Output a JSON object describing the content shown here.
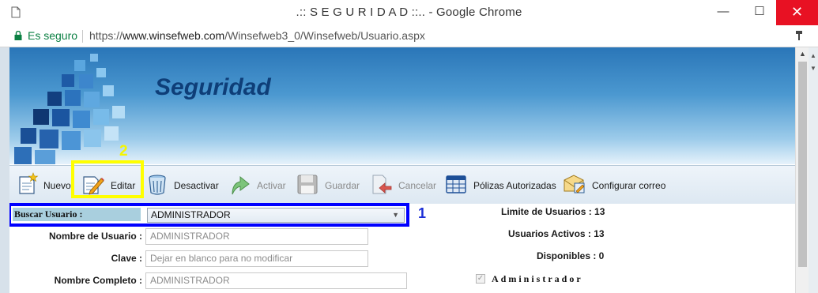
{
  "window": {
    "title": ".:: S E G U R I D A D ::.. - Google Chrome",
    "minimize": "—",
    "maximize": "☐",
    "close": "✕"
  },
  "address": {
    "secure_label": "Es seguro",
    "url_scheme": "https://",
    "url_host": "www.winsefweb.com",
    "url_path": "/Winsefweb3_0/Winsefweb/Usuario.aspx"
  },
  "banner": {
    "title": "Seguridad"
  },
  "toolbar": {
    "items": [
      {
        "label": "Nuevo",
        "icon": "new-document-icon",
        "enabled": true
      },
      {
        "label": "Editar",
        "icon": "edit-pencil-icon",
        "enabled": true
      },
      {
        "label": "Desactivar",
        "icon": "trash-bin-icon",
        "enabled": true
      },
      {
        "label": "Activar",
        "icon": "activate-arrow-icon",
        "enabled": false
      },
      {
        "label": "Guardar",
        "icon": "save-disk-icon",
        "enabled": false
      },
      {
        "label": "Cancelar",
        "icon": "cancel-undo-icon",
        "enabled": false
      },
      {
        "label": "Pólizas Autorizadas",
        "icon": "policies-table-icon",
        "enabled": true
      },
      {
        "label": "Configurar correo",
        "icon": "mail-config-icon",
        "enabled": true
      }
    ]
  },
  "annotations": {
    "marker_1": "1",
    "marker_2": "2"
  },
  "form": {
    "buscar_label": "Buscar Usuario :",
    "buscar_value": "ADMINISTRADOR",
    "nombre_usuario_label": "Nombre de Usuario :",
    "nombre_usuario_value": "ADMINISTRADOR",
    "clave_label": "Clave :",
    "clave_placeholder": "Dejar en blanco para no modificar",
    "nombre_completo_label": "Nombre Completo :",
    "nombre_completo_value": "ADMINISTRADOR",
    "limite_label": "Limite de Usuarios : 13",
    "activos_label": "Usuarios Activos : 13",
    "disponibles_label": "Disponibles : 0",
    "administrador_label": "Administrador",
    "administrador_checked": true
  },
  "colors": {
    "banner_top": "#2a76b8",
    "banner_title": "#0e3e78",
    "highlight_yellow": "#ffff00",
    "highlight_blue": "#0000ff",
    "close_button": "#e81123",
    "secure_green": "#0b8043"
  }
}
